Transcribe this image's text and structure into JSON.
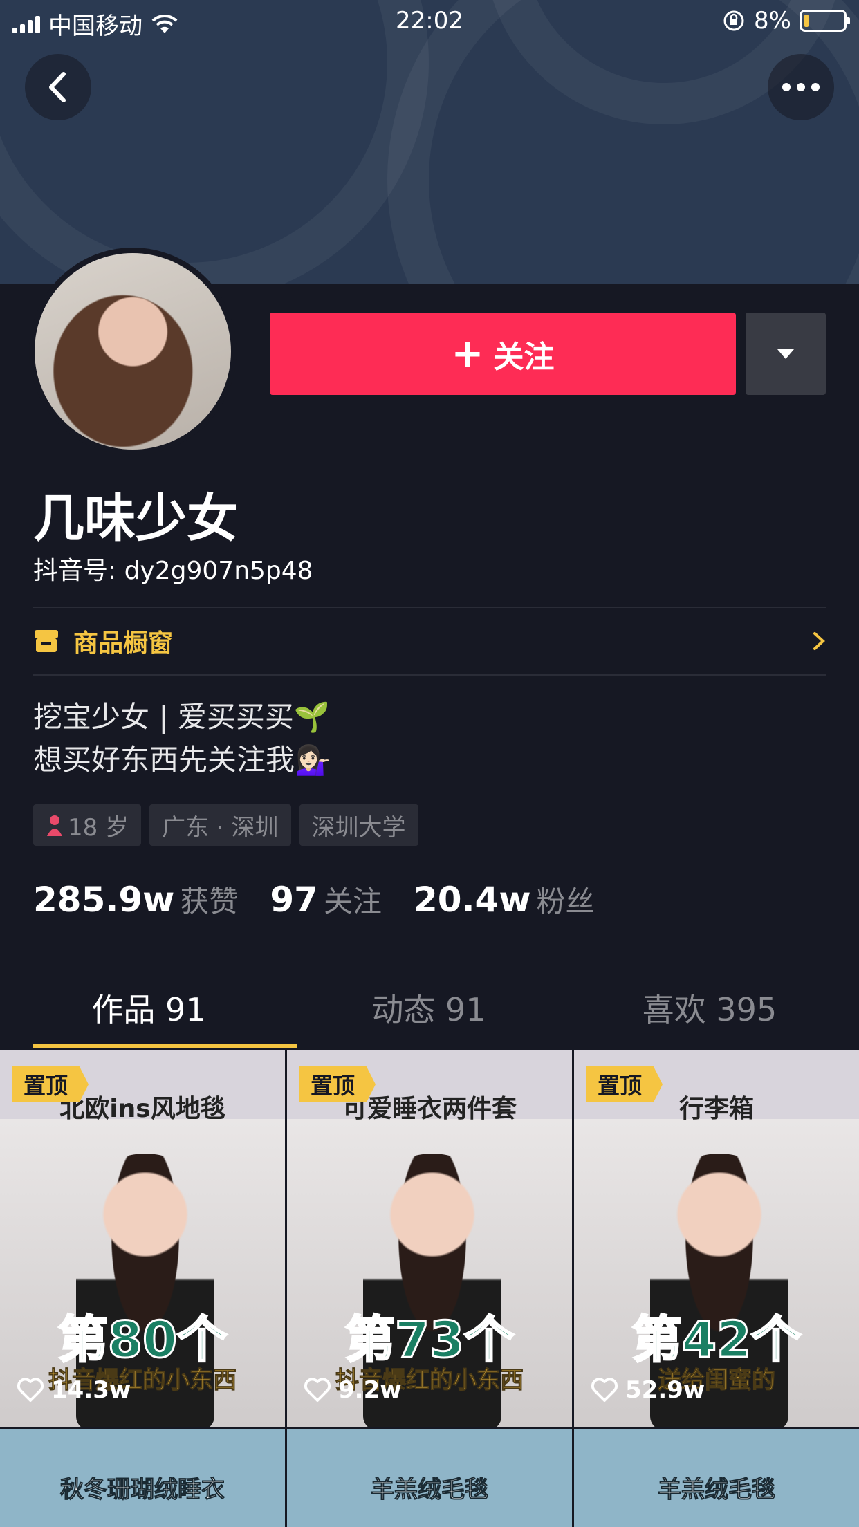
{
  "status_bar": {
    "carrier": "中国移动",
    "time": "22:02",
    "battery": "8%"
  },
  "profile": {
    "follow_label": "关注",
    "name": "几味少女",
    "douyin_id": "抖音号: dy2g907n5p48",
    "shop_label": "商品橱窗",
    "bio_line1": "挖宝少女 | 爱买买买🌱",
    "bio_line2": "想买好东西先关注我💁🏻‍♀️",
    "tags": [
      "18 岁",
      "广东 · 深圳",
      "深圳大学"
    ],
    "stats": [
      {
        "num": "285.9w",
        "label": "获赞"
      },
      {
        "num": "97",
        "label": "关注"
      },
      {
        "num": "20.4w",
        "label": "粉丝"
      }
    ]
  },
  "tabs": [
    {
      "label": "作品 91",
      "active": true
    },
    {
      "label": "动态 91",
      "active": false
    },
    {
      "label": "喜欢 395",
      "active": false
    }
  ],
  "videos": [
    {
      "pin": "置顶",
      "headline": "北欧ins风地毯",
      "big": "第80个",
      "sub": "抖音爆红的小东西",
      "likes": "14.3w"
    },
    {
      "pin": "置顶",
      "headline": "可爱睡衣两件套",
      "big": "第73个",
      "sub": "抖音爆红的小东西",
      "likes": "9.2w"
    },
    {
      "pin": "置顶",
      "headline": "行李箱",
      "big": "第42个",
      "sub": "送给闺蜜的",
      "likes": "52.9w"
    },
    {
      "headline": "秋冬珊瑚绒睡衣"
    },
    {
      "headline": "羊羔绒毛毯"
    },
    {
      "headline": "羊羔绒毛毯"
    }
  ],
  "colors": {
    "background": "#161823",
    "follow": "#fe2c55",
    "accent": "#f5c542"
  }
}
